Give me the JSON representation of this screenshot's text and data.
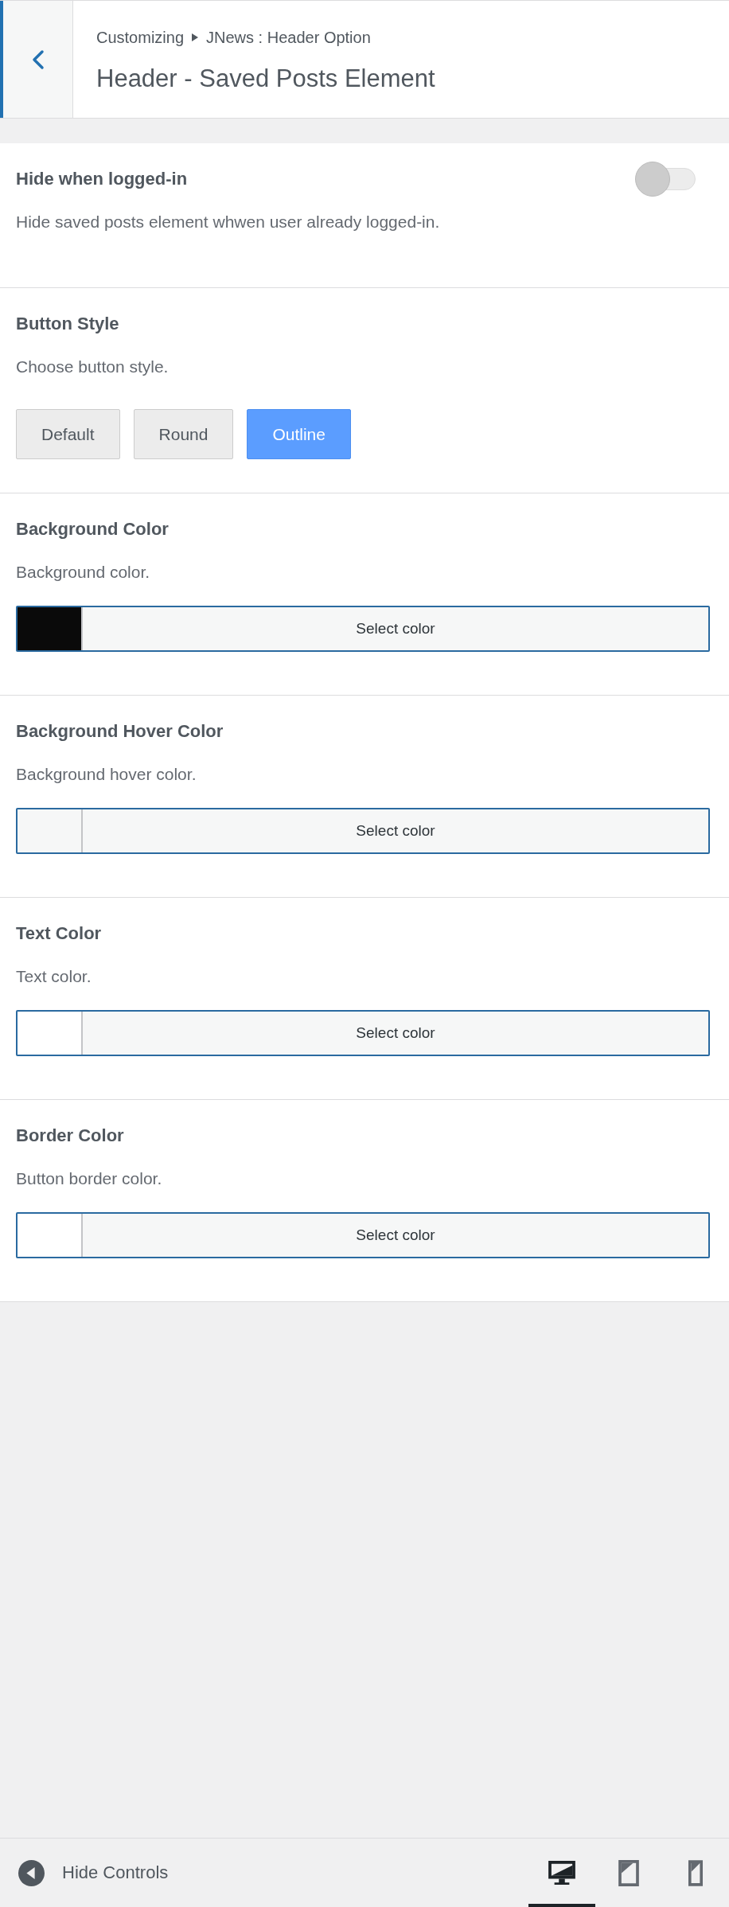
{
  "header": {
    "breadcrumb": [
      "Customizing",
      "JNews : Header Option"
    ],
    "title": "Header - Saved Posts Element"
  },
  "controls": [
    {
      "kind": "toggle",
      "label": "Hide when logged-in",
      "description": "Hide saved posts element whwen user already logged-in.",
      "on": false
    },
    {
      "kind": "buttonset",
      "label": "Button Style",
      "description": "Choose button style.",
      "options": [
        {
          "label": "Default",
          "selected": false
        },
        {
          "label": "Round",
          "selected": false
        },
        {
          "label": "Outline",
          "selected": true
        }
      ]
    },
    {
      "kind": "color",
      "label": "Background Color",
      "description": "Background color.",
      "button": "Select color",
      "color": "#0a0a0a"
    },
    {
      "kind": "color",
      "label": "Background Hover Color",
      "description": "Background hover color.",
      "button": "Select color"
    },
    {
      "kind": "color",
      "label": "Text Color",
      "description": "Text color.",
      "button": "Select color",
      "color": "#ffffff"
    },
    {
      "kind": "color",
      "label": "Border Color",
      "description": "Button border color.",
      "button": "Select color",
      "color": "#ffffff"
    }
  ],
  "footer": {
    "hide_controls": "Hide Controls",
    "devices": [
      {
        "kind": "desktop",
        "selected": true
      },
      {
        "kind": "tablet",
        "selected": false
      },
      {
        "kind": "mobile",
        "selected": false
      }
    ]
  }
}
